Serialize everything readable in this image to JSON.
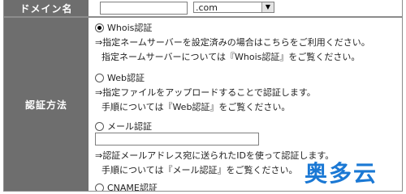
{
  "form": {
    "domain_label": "ドメイン名",
    "domain_value": "",
    "tld_selected": ".com",
    "method_label": "認証方法"
  },
  "options": {
    "whois": {
      "label": "Whois認証",
      "desc1": "⇒指定ネームサーバーを設定済みの場合はこちらをご利用ください。",
      "desc2": "指定ネームサーバーについては『Whois認証』をご覧ください。"
    },
    "web": {
      "label": "Web認証",
      "desc1": "⇒指定ファイルをアップロードすることで認証します。",
      "desc2": "手順については『Web認証』をご覧ください。"
    },
    "mail": {
      "label": "メール認証",
      "input_value": "",
      "desc1": "⇒認証メールアドレス宛に送られたIDを使って認証します。",
      "desc2": "手順については『メール認証』をご覧ください。"
    },
    "cname": {
      "label": "CNAME認証"
    }
  },
  "watermark": "奥多云"
}
